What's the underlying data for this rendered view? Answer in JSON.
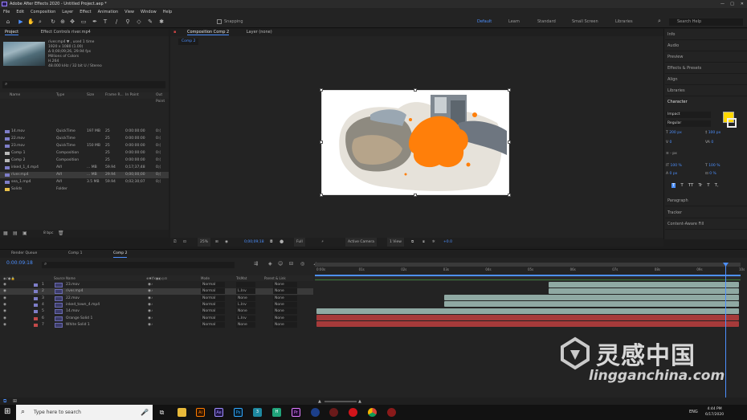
{
  "window_title": "Adobe After Effects 2020 - Untitled Project.aep *",
  "menu": [
    "File",
    "Edit",
    "Composition",
    "Layer",
    "Effect",
    "Animation",
    "View",
    "Window",
    "Help"
  ],
  "toolbar": {
    "snapping_label": "Snapping",
    "workspaces": [
      "Default",
      "Learn",
      "Standard",
      "Small Screen",
      "Libraries"
    ],
    "search_placeholder": "Search Help"
  },
  "project_panel": {
    "tab": "Project",
    "effect_controls_tab": "Effect Controls river.mp4",
    "info_lines": [
      "river.mp4 ▼ , used 1 time",
      "1920 x 1080 (1.00)",
      "Δ 0;00;09;26, 29.94 fps",
      "Millions of Colors",
      "H.264",
      "48.000 kHz / 32 bit U / Stereo"
    ],
    "columns": [
      "Name",
      "Type",
      "Size",
      "Frame R...",
      "In Point",
      "Out Point"
    ],
    "items": [
      {
        "name": "14.mov",
        "type": "QuickTime",
        "size": "197 MB",
        "fr": "25",
        "in": "0:00:00:00",
        "out": "0:("
      },
      {
        "name": "22.mov",
        "type": "QuickTime",
        "size": "",
        "fr": "25",
        "in": "0:00:00:00",
        "out": "0:("
      },
      {
        "name": "23.mov",
        "type": "QuickTime",
        "size": "150 MB",
        "fr": "25",
        "in": "0:00:00:00",
        "out": "0:("
      },
      {
        "name": "Comp 1",
        "type": "Composition",
        "size": "",
        "fr": "25",
        "in": "0:00:00:00",
        "out": "0:("
      },
      {
        "name": "Comp 2",
        "type": "Composition",
        "size": "",
        "fr": "25",
        "in": "0:00:00:00",
        "out": "0:("
      },
      {
        "name": "inked_1_4.mp4",
        "type": "AVI",
        "size": "... MB",
        "fr": "59.94",
        "in": "0;17;37;48",
        "out": "0;("
      },
      {
        "name": "river.mp4",
        "type": "AVI",
        "size": "... MB",
        "fr": "29.94",
        "in": "0;00;00;00",
        "out": "0;("
      },
      {
        "name": "sea_1.mp4",
        "type": "AVI",
        "size": "3.5 MB",
        "fr": "59.94",
        "in": "0;02;30;07",
        "out": "0;("
      },
      {
        "name": "Solids",
        "type": "Folder",
        "size": "",
        "fr": "",
        "in": "",
        "out": ""
      }
    ],
    "bpc": "8 bpc"
  },
  "comp_panel": {
    "tab": "Composition Comp 2",
    "layer_tab": "Layer (none)",
    "sub_tab": "Comp 2",
    "zoom": "25%",
    "timecode": "0;00;09;18",
    "resolution": "Full",
    "camera": "Active Camera",
    "views": "1 View",
    "exposure": "+0.0"
  },
  "right_panel": {
    "items": [
      "Info",
      "Audio",
      "Preview",
      "Effects & Presets",
      "Align",
      "Libraries"
    ],
    "character_title": "Character",
    "font": "Impact",
    "style": "Regular",
    "font_size": "200 px",
    "leading": "100 px",
    "kerning": "0",
    "tracking": "0",
    "stroke": "- px",
    "vert_scale": "100 %",
    "horiz_scale": "100 %",
    "baseline": "0 px",
    "tsume": "0 %",
    "style_buttons": [
      "T",
      "T",
      "TT",
      "Tr",
      "T",
      "T,"
    ],
    "lower_items": [
      "Paragraph",
      "Tracker",
      "Content-Aware Fill"
    ],
    "fill_color": "#ffd800"
  },
  "timeline": {
    "tabs": [
      "Render Queue",
      "Comp 1",
      "Comp 2"
    ],
    "timecode": "0:00:09:18",
    "col_source": "Source Name",
    "col_mode": "Mode",
    "col_trkmat": "TrkMat",
    "col_parent": "Parent & Link",
    "ruler": [
      "0:00s",
      "01s",
      "02s",
      "03s",
      "04s",
      "05s",
      "06s",
      "07s",
      "08s",
      "09s",
      "10s"
    ],
    "layers": [
      {
        "num": "1",
        "name": "23.mov",
        "mode": "Normal",
        "trk": "",
        "parent": "None",
        "color": "#7e7ec8",
        "bar_color": "#8fa9a3",
        "start": 0.545,
        "end": 1.0
      },
      {
        "num": "2",
        "name": "river.mp4",
        "mode": "Normal",
        "trk": "L.Inv",
        "parent": "None",
        "color": "#7e7ec8",
        "bar_color": "#8fa9a3",
        "start": 0.545,
        "end": 1.0
      },
      {
        "num": "3",
        "name": "22.mov",
        "mode": "Normal",
        "trk": "None",
        "parent": "None",
        "color": "#7e7ec8",
        "bar_color": "#8fa9a3",
        "start": 0.3,
        "end": 1.0
      },
      {
        "num": "4",
        "name": "inked_town_4.mp4",
        "mode": "Normal",
        "trk": "L.Inv",
        "parent": "None",
        "color": "#7e7ec8",
        "bar_color": "#8fa9a3",
        "start": 0.3,
        "end": 1.0
      },
      {
        "num": "5",
        "name": "14.mov",
        "mode": "Normal",
        "trk": "None",
        "parent": "None",
        "color": "#7e7ec8",
        "bar_color": "#8fa9a3",
        "start": 0.0,
        "end": 1.0
      },
      {
        "num": "6",
        "name": "Orange Solid 1",
        "mode": "Normal",
        "trk": "L.Inv",
        "parent": "None",
        "color": "#c44a4a",
        "bar_color": "#a63a3a",
        "start": 0.0,
        "end": 1.0
      },
      {
        "num": "7",
        "name": "White Solid 1",
        "mode": "Normal",
        "trk": "None",
        "parent": "None",
        "color": "#c44a4a",
        "bar_color": "#a63a3a",
        "start": 0.0,
        "end": 1.0
      }
    ]
  },
  "taskbar": {
    "search_placeholder": "Type here to search",
    "time": "4:44 PM",
    "date": "6/17/2020",
    "lang": "ENG"
  },
  "watermark": {
    "cn": "灵感中国",
    "en": "lingganchina.com"
  }
}
